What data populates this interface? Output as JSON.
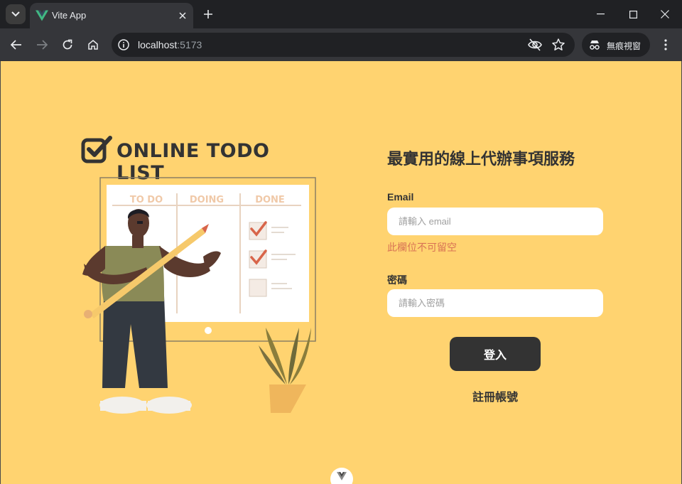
{
  "browser": {
    "tab_title": "Vite App",
    "url_host": "localhost",
    "url_port": ":5173",
    "incognito_label": "無痕視窗"
  },
  "page": {
    "logo_text": "ONLINE TODO LIST",
    "board_columns": [
      "TO DO",
      "DOING",
      "DONE"
    ],
    "heading": "最實用的線上代辦事項服務",
    "email_label": "Email",
    "email_placeholder": "請輸入 email",
    "email_error": "此欄位不可留空",
    "password_label": "密碼",
    "password_placeholder": "請輸入密碼",
    "login_button": "登入",
    "register_link": "註冊帳號"
  },
  "colors": {
    "background": "#ffd370",
    "primary_text": "#333333",
    "error": "#d87355"
  },
  "icons": [
    "tab-search-icon",
    "vue-logo-icon",
    "close-icon",
    "plus-icon",
    "minimize-icon",
    "maximize-icon",
    "window-close-icon",
    "back-icon",
    "forward-icon",
    "reload-icon",
    "home-icon",
    "site-info-icon",
    "eye-off-icon",
    "star-icon",
    "incognito-icon",
    "kebab-menu-icon",
    "checkbox-logo-icon",
    "vue-devtools-icon"
  ]
}
